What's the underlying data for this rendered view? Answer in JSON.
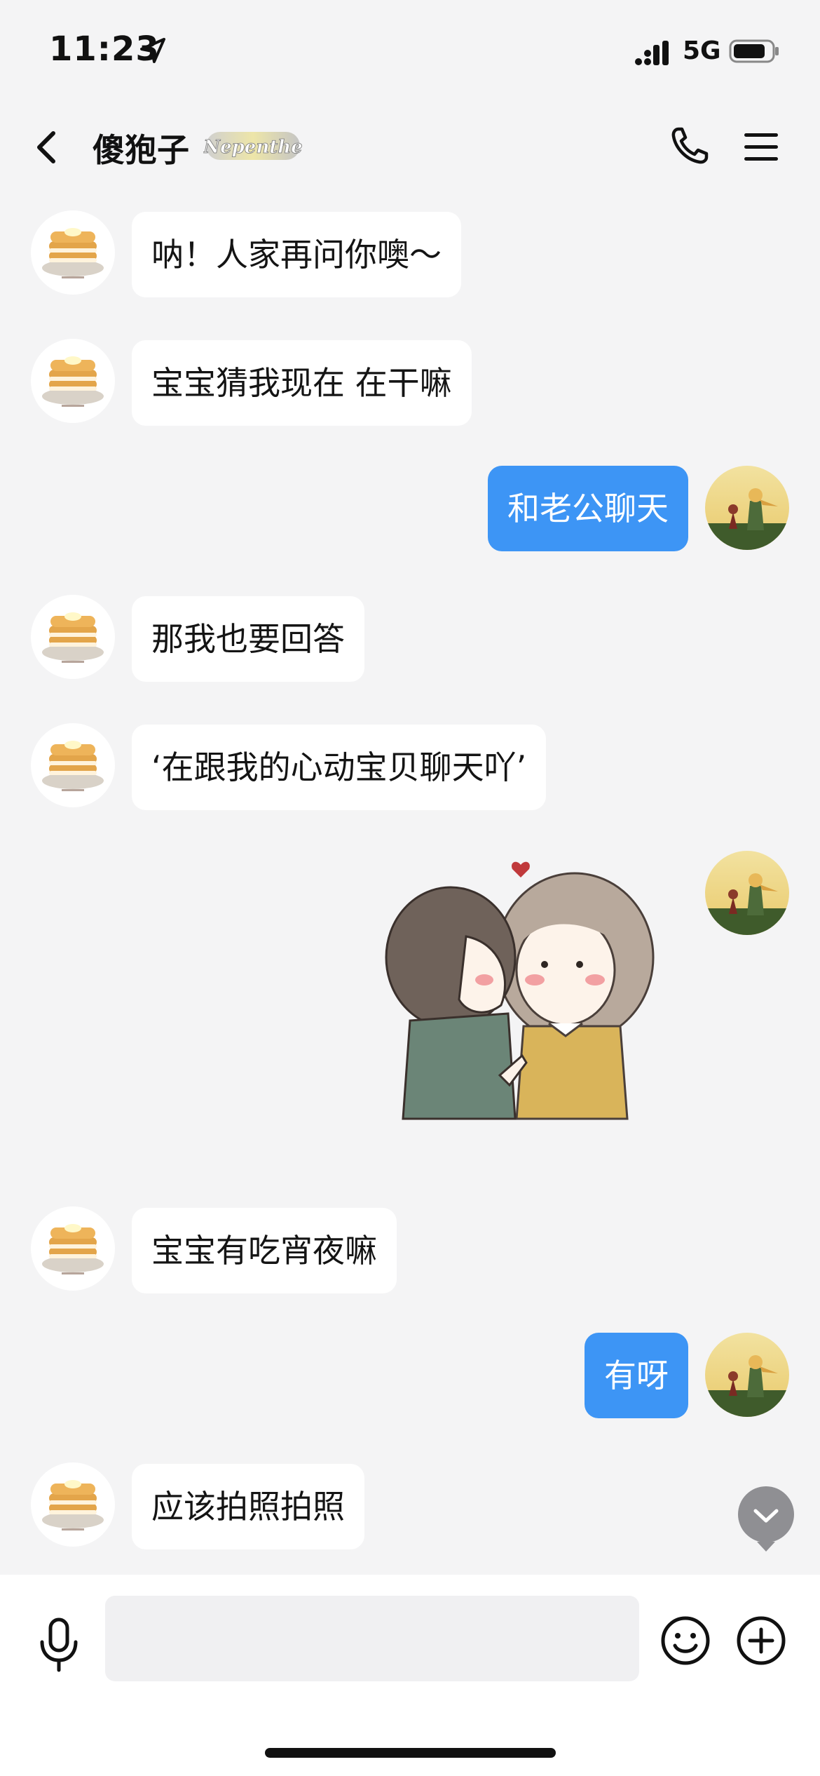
{
  "status_bar": {
    "time": "11:23",
    "network": "5G"
  },
  "header": {
    "contact_name": "傻狍子",
    "badge_text": "Nepenthe"
  },
  "messages": [
    {
      "side": "in",
      "text": "呐！人家再问你噢～"
    },
    {
      "side": "in",
      "text": "宝宝猜我现在 在干嘛"
    },
    {
      "side": "out",
      "text": "和老公聊天"
    },
    {
      "side": "in",
      "text": "那我也要回答"
    },
    {
      "side": "in",
      "text": "‘在跟我的心动宝贝聊天吖’"
    },
    {
      "side": "out",
      "type": "sticker"
    },
    {
      "side": "in",
      "text": "宝宝有吃宵夜嘛"
    },
    {
      "side": "out",
      "text": "有呀"
    },
    {
      "side": "in",
      "text": "应该拍照拍照"
    }
  ],
  "input": {
    "placeholder": ""
  },
  "colors": {
    "outgoing_bubble": "#3d95f5",
    "incoming_bubble": "#ffffff",
    "background": "#f4f4f5"
  }
}
